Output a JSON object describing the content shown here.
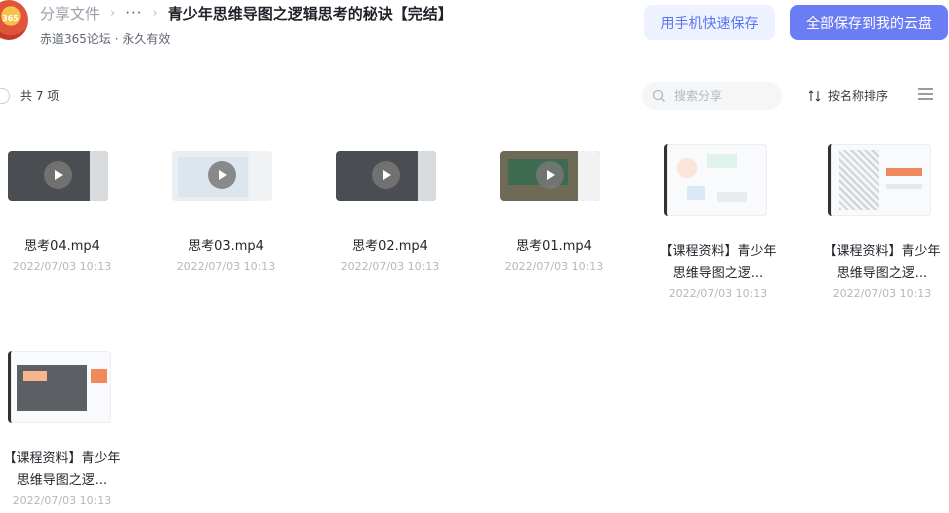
{
  "header": {
    "breadcrumb_root": "分享文件",
    "more": "···",
    "title": "青少年思维导图之逻辑思考的秘诀【完结】",
    "sub_info": "赤道365论坛 · 永久有效",
    "btn_mobile": "用手机快速保存",
    "btn_save_all": "全部保存到我的云盘"
  },
  "toolbar": {
    "count": "共 7 项",
    "search_placeholder": "搜索分享",
    "sort_label": "按名称排序"
  },
  "files": [
    {
      "name": "思考04.mp4",
      "date": "2022/07/03 10:13",
      "type": "video"
    },
    {
      "name": "思考03.mp4",
      "date": "2022/07/03 10:13",
      "type": "video"
    },
    {
      "name": "思考02.mp4",
      "date": "2022/07/03 10:13",
      "type": "video"
    },
    {
      "name": "思考01.mp4",
      "date": "2022/07/03 10:13",
      "type": "video"
    },
    {
      "name": "【课程资料】青少年思维导图之逻...",
      "date": "2022/07/03 10:13",
      "type": "doc"
    },
    {
      "name": "【课程资料】青少年思维导图之逻...",
      "date": "2022/07/03 10:13",
      "type": "doc"
    },
    {
      "name": "【课程资料】青少年思维导图之逻...",
      "date": "2022/07/03 10:13",
      "type": "doc"
    }
  ],
  "colors": {
    "accent": "#6b7df5",
    "accent_light": "#eef2ff"
  }
}
